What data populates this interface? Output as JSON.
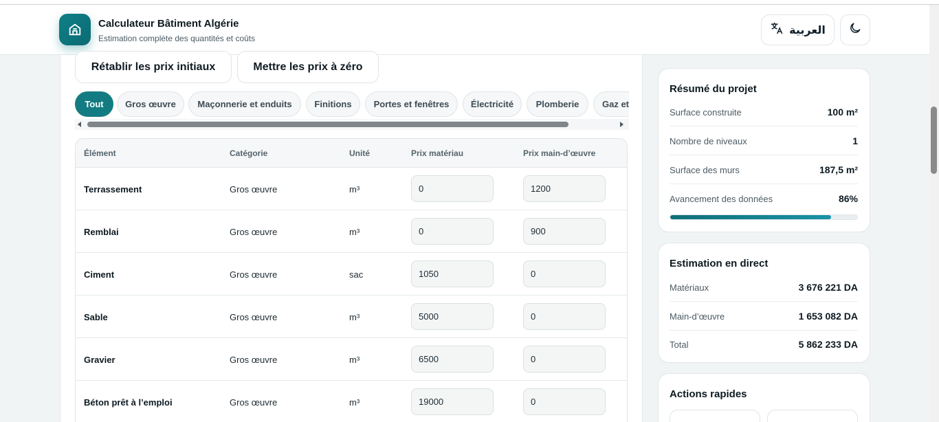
{
  "header": {
    "app_title": "Calculateur Bâtiment Algérie",
    "app_subtitle": "Estimation complète des quantités et coûts",
    "language_label": "العربية",
    "icons": {
      "logo": "house-icon",
      "language": "translate-icon",
      "theme": "moon-icon"
    }
  },
  "actions": {
    "reset_label": "Rétablir les prix initiaux",
    "zero_label": "Mettre les prix à zéro"
  },
  "tabs": [
    {
      "label": "Tout",
      "active": true
    },
    {
      "label": "Gros œuvre"
    },
    {
      "label": "Maçonnerie et enduits"
    },
    {
      "label": "Finitions"
    },
    {
      "label": "Portes et fenêtres"
    },
    {
      "label": "Électricité"
    },
    {
      "label": "Plomberie"
    },
    {
      "label": "Gaz et"
    }
  ],
  "table": {
    "headers": [
      "Élément",
      "Catégorie",
      "Unité",
      "Prix matériau",
      "Prix main-d’œuvre"
    ],
    "rows": [
      {
        "element": "Terrassement",
        "category": "Gros œuvre",
        "unit": "m³",
        "material_price": "0",
        "labor_price": "1200"
      },
      {
        "element": "Remblai",
        "category": "Gros œuvre",
        "unit": "m³",
        "material_price": "0",
        "labor_price": "900"
      },
      {
        "element": "Ciment",
        "category": "Gros œuvre",
        "unit": "sac",
        "material_price": "1050",
        "labor_price": "0"
      },
      {
        "element": "Sable",
        "category": "Gros œuvre",
        "unit": "m³",
        "material_price": "5000",
        "labor_price": "0"
      },
      {
        "element": "Gravier",
        "category": "Gros œuvre",
        "unit": "m³",
        "material_price": "6500",
        "labor_price": "0"
      },
      {
        "element": "Béton prêt à l’emploi",
        "category": "Gros œuvre",
        "unit": "m³",
        "material_price": "19000",
        "labor_price": "0"
      }
    ]
  },
  "summary": {
    "title": "Résumé du projet",
    "items": [
      {
        "label": "Surface construite",
        "value": "100 m²"
      },
      {
        "label": "Nombre de niveaux",
        "value": "1"
      },
      {
        "label": "Surface des murs",
        "value": "187,5 m²"
      },
      {
        "label": "Avancement des données",
        "value": "86%"
      }
    ],
    "progress_fraction": 0.86
  },
  "estimate": {
    "title": "Estimation en direct",
    "items": [
      {
        "label": "Matériaux",
        "value": "3 676 221 DA"
      },
      {
        "label": "Main-d’œuvre",
        "value": "1 653 082 DA"
      },
      {
        "label": "Total",
        "value": "5 862 233 DA"
      }
    ]
  },
  "quick_actions": {
    "title": "Actions rapides"
  },
  "colors": {
    "accent": "#137c82",
    "background": "#f1f4f5"
  }
}
